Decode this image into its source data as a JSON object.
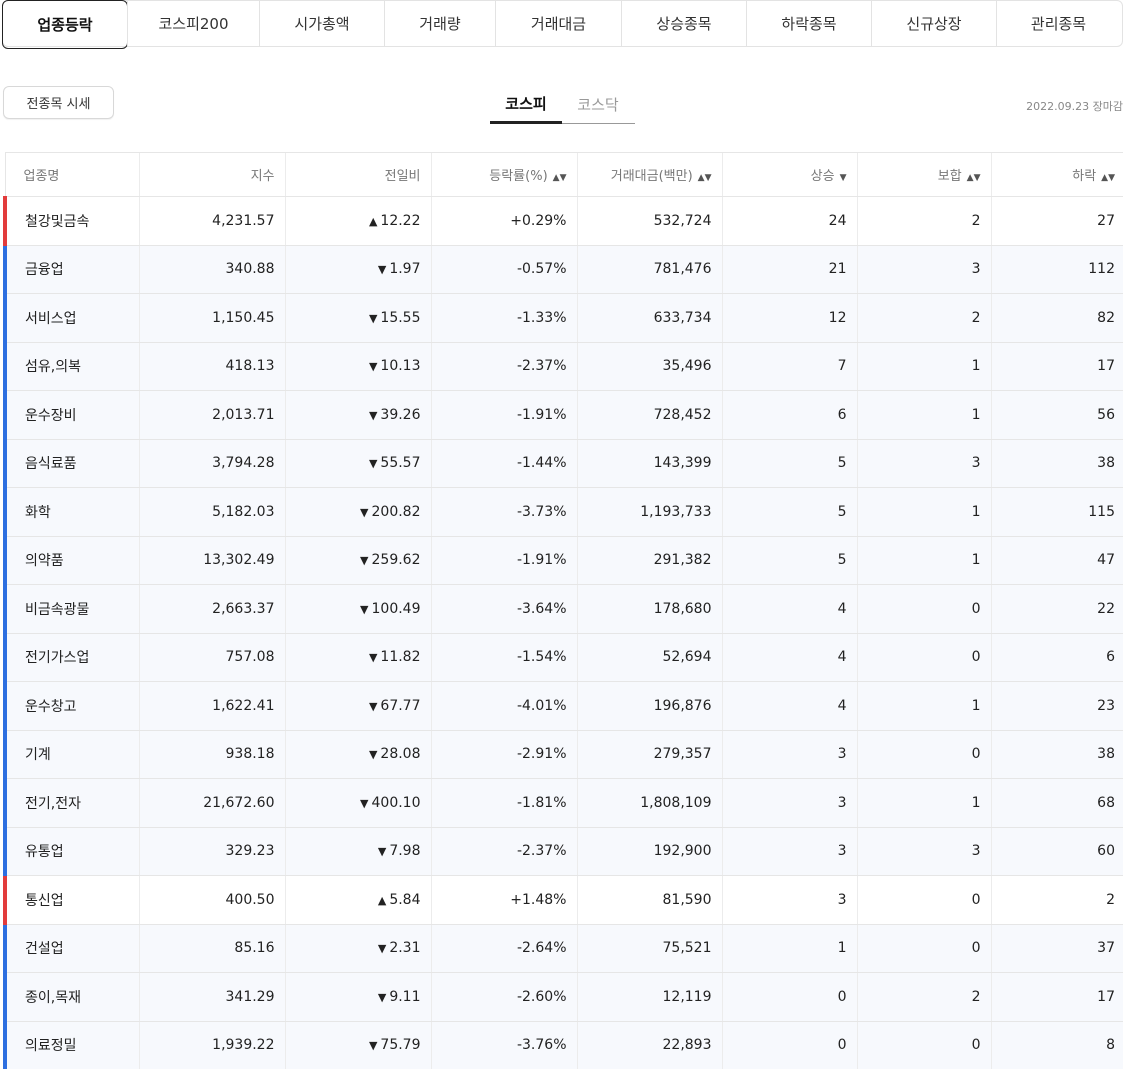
{
  "top_tabs": [
    "업종등락",
    "코스피200",
    "시가총액",
    "거래량",
    "거래대금",
    "상승종목",
    "하락종목",
    "신규상장",
    "관리종목"
  ],
  "all_button": "전종목 시세",
  "market_tabs": [
    "코스피",
    "코스닥"
  ],
  "date": "2022.09.23 장마감",
  "columns": {
    "name": "업종명",
    "index": "지수",
    "change": "전일비",
    "rate": "등락률(%)",
    "amount": "거래대금(백만)",
    "rise": "상승",
    "flat": "보합",
    "fall": "하락"
  },
  "icons": {
    "up": "▲",
    "down": "▼",
    "sort_both": "▲▼",
    "sort_desc": "▼"
  },
  "colors": {
    "up": "#e01b1b",
    "down": "#1f6fd6"
  },
  "rows": [
    {
      "name": "철강및금속",
      "index": "4,231.57",
      "dir": "up",
      "change": "12.22",
      "rate": "+0.29%",
      "amount": "532,724",
      "rise": "24",
      "flat": "2",
      "fall": "27"
    },
    {
      "name": "금융업",
      "index": "340.88",
      "dir": "down",
      "change": "1.97",
      "rate": "-0.57%",
      "amount": "781,476",
      "rise": "21",
      "flat": "3",
      "fall": "112"
    },
    {
      "name": "서비스업",
      "index": "1,150.45",
      "dir": "down",
      "change": "15.55",
      "rate": "-1.33%",
      "amount": "633,734",
      "rise": "12",
      "flat": "2",
      "fall": "82"
    },
    {
      "name": "섬유,의복",
      "index": "418.13",
      "dir": "down",
      "change": "10.13",
      "rate": "-2.37%",
      "amount": "35,496",
      "rise": "7",
      "flat": "1",
      "fall": "17"
    },
    {
      "name": "운수장비",
      "index": "2,013.71",
      "dir": "down",
      "change": "39.26",
      "rate": "-1.91%",
      "amount": "728,452",
      "rise": "6",
      "flat": "1",
      "fall": "56"
    },
    {
      "name": "음식료품",
      "index": "3,794.28",
      "dir": "down",
      "change": "55.57",
      "rate": "-1.44%",
      "amount": "143,399",
      "rise": "5",
      "flat": "3",
      "fall": "38"
    },
    {
      "name": "화학",
      "index": "5,182.03",
      "dir": "down",
      "change": "200.82",
      "rate": "-3.73%",
      "amount": "1,193,733",
      "rise": "5",
      "flat": "1",
      "fall": "115"
    },
    {
      "name": "의약품",
      "index": "13,302.49",
      "dir": "down",
      "change": "259.62",
      "rate": "-1.91%",
      "amount": "291,382",
      "rise": "5",
      "flat": "1",
      "fall": "47"
    },
    {
      "name": "비금속광물",
      "index": "2,663.37",
      "dir": "down",
      "change": "100.49",
      "rate": "-3.64%",
      "amount": "178,680",
      "rise": "4",
      "flat": "0",
      "fall": "22"
    },
    {
      "name": "전기가스업",
      "index": "757.08",
      "dir": "down",
      "change": "11.82",
      "rate": "-1.54%",
      "amount": "52,694",
      "rise": "4",
      "flat": "0",
      "fall": "6"
    },
    {
      "name": "운수창고",
      "index": "1,622.41",
      "dir": "down",
      "change": "67.77",
      "rate": "-4.01%",
      "amount": "196,876",
      "rise": "4",
      "flat": "1",
      "fall": "23"
    },
    {
      "name": "기계",
      "index": "938.18",
      "dir": "down",
      "change": "28.08",
      "rate": "-2.91%",
      "amount": "279,357",
      "rise": "3",
      "flat": "0",
      "fall": "38"
    },
    {
      "name": "전기,전자",
      "index": "21,672.60",
      "dir": "down",
      "change": "400.10",
      "rate": "-1.81%",
      "amount": "1,808,109",
      "rise": "3",
      "flat": "1",
      "fall": "68"
    },
    {
      "name": "유통업",
      "index": "329.23",
      "dir": "down",
      "change": "7.98",
      "rate": "-2.37%",
      "amount": "192,900",
      "rise": "3",
      "flat": "3",
      "fall": "60"
    },
    {
      "name": "통신업",
      "index": "400.50",
      "dir": "up",
      "change": "5.84",
      "rate": "+1.48%",
      "amount": "81,590",
      "rise": "3",
      "flat": "0",
      "fall": "2"
    },
    {
      "name": "건설업",
      "index": "85.16",
      "dir": "down",
      "change": "2.31",
      "rate": "-2.64%",
      "amount": "75,521",
      "rise": "1",
      "flat": "0",
      "fall": "37"
    },
    {
      "name": "종이,목재",
      "index": "341.29",
      "dir": "down",
      "change": "9.11",
      "rate": "-2.60%",
      "amount": "12,119",
      "rise": "0",
      "flat": "2",
      "fall": "17"
    },
    {
      "name": "의료정밀",
      "index": "1,939.22",
      "dir": "down",
      "change": "75.79",
      "rate": "-3.76%",
      "amount": "22,893",
      "rise": "0",
      "flat": "0",
      "fall": "8"
    }
  ]
}
